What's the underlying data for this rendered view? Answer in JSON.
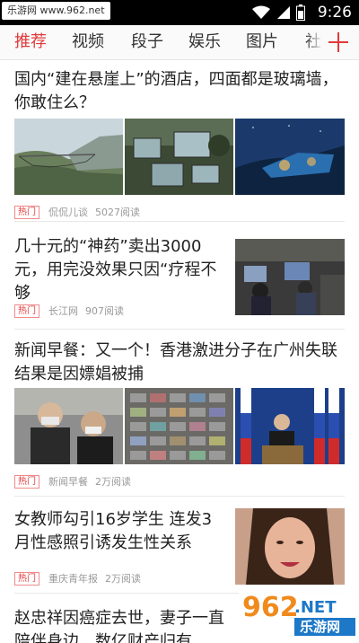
{
  "status_bar": {
    "watermark": "乐游网 www.962.net",
    "time": "9:26"
  },
  "tabs": [
    {
      "label": "推荐",
      "active": true
    },
    {
      "label": "视频",
      "active": false
    },
    {
      "label": "段子",
      "active": false
    },
    {
      "label": "娱乐",
      "active": false
    },
    {
      "label": "图片",
      "active": false
    },
    {
      "label": "社",
      "active": false
    }
  ],
  "articles": [
    {
      "title": "国内“建在悬崖上”的酒店，四面都是玻璃墙，你敢住么？",
      "badge": "热门",
      "source": "侃侃儿谈",
      "reads": "5027阅读"
    },
    {
      "title": "几十元的“神药”卖出3000元，用完没效果只因“疗程不够",
      "badge": "热门",
      "source": "长江网",
      "reads": "907阅读"
    },
    {
      "title": "新闻早餐：又一个！香港激进分子在广州失联 结果是因嫖娼被捕",
      "badge": "热门",
      "source": "新闻早餐",
      "reads": "2万阅读"
    },
    {
      "title": "女教师勾引16岁学生 连发3月性感照引诱发生性关系",
      "badge": "热门",
      "source": "重庆青年报",
      "reads": "2万阅读"
    },
    {
      "title": "赵忠祥因癌症去世，妻子一直陪伴身边，数亿财产归有",
      "badge": "",
      "source": "",
      "reads": ""
    }
  ],
  "watermark_logo": {
    "text_main": "962",
    "text_suffix": ".NET",
    "text_sub": "乐游网"
  },
  "colors": {
    "accent": "#e23a3a"
  }
}
